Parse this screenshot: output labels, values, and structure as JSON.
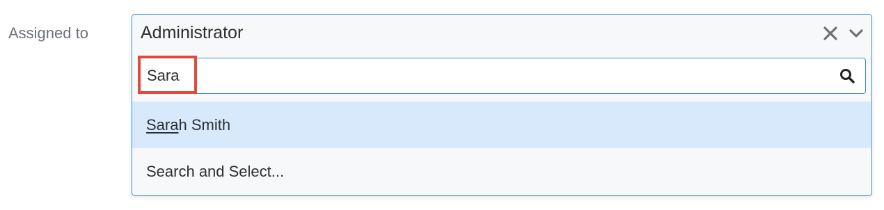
{
  "field": {
    "label": "Assigned to"
  },
  "select": {
    "selected_value": "Administrator",
    "icons": {
      "clear": "close-icon",
      "toggle": "chevron-down-icon"
    },
    "accent_color": "#3b8edb"
  },
  "search": {
    "value": "Sara",
    "icon": "search-icon",
    "highlight_color": "#e04a3a"
  },
  "results": [
    {
      "match": "Sara",
      "rest": "h Smith",
      "active": true
    },
    {
      "match": "",
      "rest": "Search and Select...",
      "active": false
    }
  ],
  "colors": {
    "active_row": "#d8e9fb",
    "label_text": "#6b7178"
  }
}
